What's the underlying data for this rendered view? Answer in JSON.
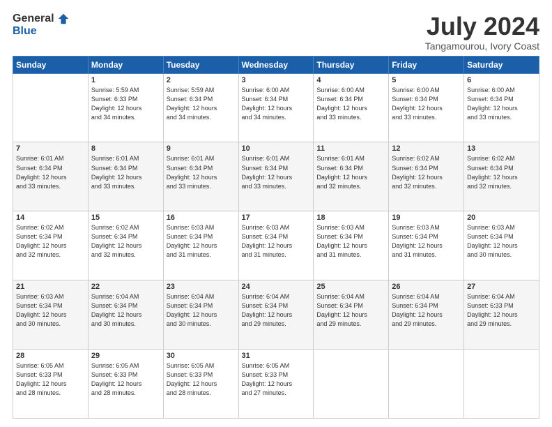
{
  "header": {
    "logo_general": "General",
    "logo_blue": "Blue",
    "month_title": "July 2024",
    "location": "Tangamourou, Ivory Coast"
  },
  "days_of_week": [
    "Sunday",
    "Monday",
    "Tuesday",
    "Wednesday",
    "Thursday",
    "Friday",
    "Saturday"
  ],
  "weeks": [
    [
      {
        "day": "",
        "sunrise": "",
        "sunset": "",
        "daylight": ""
      },
      {
        "day": "1",
        "sunrise": "Sunrise: 5:59 AM",
        "sunset": "Sunset: 6:33 PM",
        "daylight": "Daylight: 12 hours and 34 minutes."
      },
      {
        "day": "2",
        "sunrise": "Sunrise: 5:59 AM",
        "sunset": "Sunset: 6:34 PM",
        "daylight": "Daylight: 12 hours and 34 minutes."
      },
      {
        "day": "3",
        "sunrise": "Sunrise: 6:00 AM",
        "sunset": "Sunset: 6:34 PM",
        "daylight": "Daylight: 12 hours and 34 minutes."
      },
      {
        "day": "4",
        "sunrise": "Sunrise: 6:00 AM",
        "sunset": "Sunset: 6:34 PM",
        "daylight": "Daylight: 12 hours and 33 minutes."
      },
      {
        "day": "5",
        "sunrise": "Sunrise: 6:00 AM",
        "sunset": "Sunset: 6:34 PM",
        "daylight": "Daylight: 12 hours and 33 minutes."
      },
      {
        "day": "6",
        "sunrise": "Sunrise: 6:00 AM",
        "sunset": "Sunset: 6:34 PM",
        "daylight": "Daylight: 12 hours and 33 minutes."
      }
    ],
    [
      {
        "day": "7",
        "sunrise": "Sunrise: 6:01 AM",
        "sunset": "Sunset: 6:34 PM",
        "daylight": "Daylight: 12 hours and 33 minutes."
      },
      {
        "day": "8",
        "sunrise": "Sunrise: 6:01 AM",
        "sunset": "Sunset: 6:34 PM",
        "daylight": "Daylight: 12 hours and 33 minutes."
      },
      {
        "day": "9",
        "sunrise": "Sunrise: 6:01 AM",
        "sunset": "Sunset: 6:34 PM",
        "daylight": "Daylight: 12 hours and 33 minutes."
      },
      {
        "day": "10",
        "sunrise": "Sunrise: 6:01 AM",
        "sunset": "Sunset: 6:34 PM",
        "daylight": "Daylight: 12 hours and 33 minutes."
      },
      {
        "day": "11",
        "sunrise": "Sunrise: 6:01 AM",
        "sunset": "Sunset: 6:34 PM",
        "daylight": "Daylight: 12 hours and 32 minutes."
      },
      {
        "day": "12",
        "sunrise": "Sunrise: 6:02 AM",
        "sunset": "Sunset: 6:34 PM",
        "daylight": "Daylight: 12 hours and 32 minutes."
      },
      {
        "day": "13",
        "sunrise": "Sunrise: 6:02 AM",
        "sunset": "Sunset: 6:34 PM",
        "daylight": "Daylight: 12 hours and 32 minutes."
      }
    ],
    [
      {
        "day": "14",
        "sunrise": "Sunrise: 6:02 AM",
        "sunset": "Sunset: 6:34 PM",
        "daylight": "Daylight: 12 hours and 32 minutes."
      },
      {
        "day": "15",
        "sunrise": "Sunrise: 6:02 AM",
        "sunset": "Sunset: 6:34 PM",
        "daylight": "Daylight: 12 hours and 32 minutes."
      },
      {
        "day": "16",
        "sunrise": "Sunrise: 6:03 AM",
        "sunset": "Sunset: 6:34 PM",
        "daylight": "Daylight: 12 hours and 31 minutes."
      },
      {
        "day": "17",
        "sunrise": "Sunrise: 6:03 AM",
        "sunset": "Sunset: 6:34 PM",
        "daylight": "Daylight: 12 hours and 31 minutes."
      },
      {
        "day": "18",
        "sunrise": "Sunrise: 6:03 AM",
        "sunset": "Sunset: 6:34 PM",
        "daylight": "Daylight: 12 hours and 31 minutes."
      },
      {
        "day": "19",
        "sunrise": "Sunrise: 6:03 AM",
        "sunset": "Sunset: 6:34 PM",
        "daylight": "Daylight: 12 hours and 31 minutes."
      },
      {
        "day": "20",
        "sunrise": "Sunrise: 6:03 AM",
        "sunset": "Sunset: 6:34 PM",
        "daylight": "Daylight: 12 hours and 30 minutes."
      }
    ],
    [
      {
        "day": "21",
        "sunrise": "Sunrise: 6:03 AM",
        "sunset": "Sunset: 6:34 PM",
        "daylight": "Daylight: 12 hours and 30 minutes."
      },
      {
        "day": "22",
        "sunrise": "Sunrise: 6:04 AM",
        "sunset": "Sunset: 6:34 PM",
        "daylight": "Daylight: 12 hours and 30 minutes."
      },
      {
        "day": "23",
        "sunrise": "Sunrise: 6:04 AM",
        "sunset": "Sunset: 6:34 PM",
        "daylight": "Daylight: 12 hours and 30 minutes."
      },
      {
        "day": "24",
        "sunrise": "Sunrise: 6:04 AM",
        "sunset": "Sunset: 6:34 PM",
        "daylight": "Daylight: 12 hours and 29 minutes."
      },
      {
        "day": "25",
        "sunrise": "Sunrise: 6:04 AM",
        "sunset": "Sunset: 6:34 PM",
        "daylight": "Daylight: 12 hours and 29 minutes."
      },
      {
        "day": "26",
        "sunrise": "Sunrise: 6:04 AM",
        "sunset": "Sunset: 6:34 PM",
        "daylight": "Daylight: 12 hours and 29 minutes."
      },
      {
        "day": "27",
        "sunrise": "Sunrise: 6:04 AM",
        "sunset": "Sunset: 6:33 PM",
        "daylight": "Daylight: 12 hours and 29 minutes."
      }
    ],
    [
      {
        "day": "28",
        "sunrise": "Sunrise: 6:05 AM",
        "sunset": "Sunset: 6:33 PM",
        "daylight": "Daylight: 12 hours and 28 minutes."
      },
      {
        "day": "29",
        "sunrise": "Sunrise: 6:05 AM",
        "sunset": "Sunset: 6:33 PM",
        "daylight": "Daylight: 12 hours and 28 minutes."
      },
      {
        "day": "30",
        "sunrise": "Sunrise: 6:05 AM",
        "sunset": "Sunset: 6:33 PM",
        "daylight": "Daylight: 12 hours and 28 minutes."
      },
      {
        "day": "31",
        "sunrise": "Sunrise: 6:05 AM",
        "sunset": "Sunset: 6:33 PM",
        "daylight": "Daylight: 12 hours and 27 minutes."
      },
      {
        "day": "",
        "sunrise": "",
        "sunset": "",
        "daylight": ""
      },
      {
        "day": "",
        "sunrise": "",
        "sunset": "",
        "daylight": ""
      },
      {
        "day": "",
        "sunrise": "",
        "sunset": "",
        "daylight": ""
      }
    ]
  ]
}
